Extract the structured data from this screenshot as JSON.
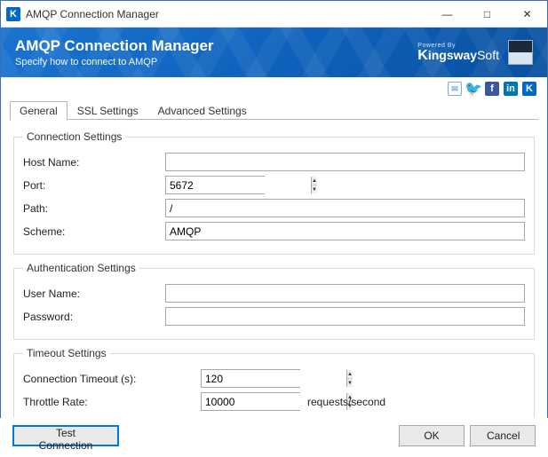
{
  "window": {
    "title": "AMQP Connection Manager"
  },
  "banner": {
    "title": "AMQP Connection Manager",
    "subtitle": "Specify how to connect to AMQP",
    "powered_by": "Powered By",
    "brand": "KingswaySoft"
  },
  "tabs": {
    "general": "General",
    "ssl": "SSL Settings",
    "advanced": "Advanced Settings"
  },
  "groups": {
    "connection": {
      "legend": "Connection Settings",
      "host_label": "Host Name:",
      "host_value": "",
      "port_label": "Port:",
      "port_value": "5672",
      "path_label": "Path:",
      "path_value": "/",
      "scheme_label": "Scheme:",
      "scheme_value": "AMQP"
    },
    "auth": {
      "legend": "Authentication Settings",
      "user_label": "User Name:",
      "user_value": "",
      "pass_label": "Password:",
      "pass_value": ""
    },
    "timeout": {
      "legend": "Timeout Settings",
      "conn_label": "Connection Timeout (s):",
      "conn_value": "120",
      "throttle_label": "Throttle Rate:",
      "throttle_value": "10000",
      "throttle_unit": "requests/second"
    }
  },
  "footer": {
    "test": "Test Connection",
    "ok": "OK",
    "cancel": "Cancel"
  }
}
